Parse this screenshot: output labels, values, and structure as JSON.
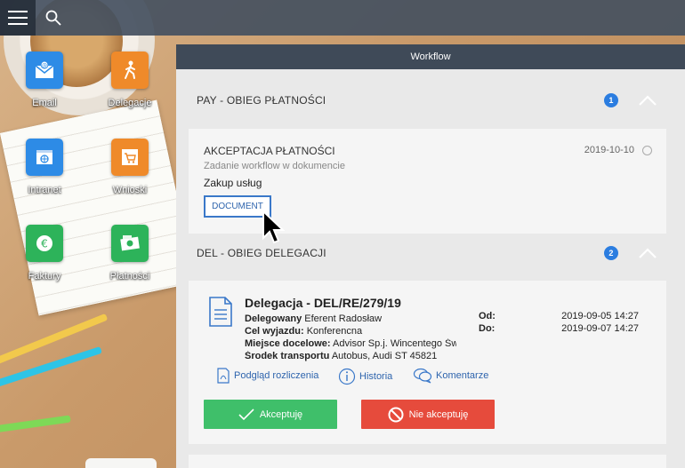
{
  "colors": {
    "topbar": "#445060",
    "panel_header": "#3f4a58",
    "badge": "#2b7de0",
    "accent_link": "#2e64ad",
    "accept": "#3fbf6a",
    "reject": "#e64b3c"
  },
  "topbar": {
    "menu_icon": "hamburger-icon",
    "search_icon": "search-icon"
  },
  "desktop_apps": [
    {
      "label": "Email",
      "icon": "email-icon",
      "color": "#2d8be6"
    },
    {
      "label": "Delegacje",
      "icon": "walking-person-icon",
      "color": "#ef8a2a"
    },
    {
      "label": "Intranet",
      "icon": "globe-window-icon",
      "color": "#2d8be6"
    },
    {
      "label": "Wnioski",
      "icon": "cart-icon",
      "color": "#ef8a2a"
    },
    {
      "label": "Faktury",
      "icon": "euro-icon",
      "color": "#2db35a"
    },
    {
      "label": "Płatności",
      "icon": "cash-icon",
      "color": "#2db35a"
    }
  ],
  "workflow": {
    "title": "Workflow",
    "sections": [
      {
        "title": "PAY - OBIEG PŁATNOŚCI",
        "count": "1",
        "card": {
          "title": "AKCEPTACJA PŁATNOŚCI",
          "subtitle": "Zadanie workflow w dokumencie",
          "description": "Zakup usług",
          "date": "2019-10-10",
          "button": "DOCUMENT"
        }
      },
      {
        "title": "DEL - OBIEG DELEGACJI",
        "count": "2",
        "card": {
          "title": "Delegacja - DEL/RE/279/19",
          "fields": [
            {
              "key": "Delegowany",
              "value": "Eferent Radosław"
            },
            {
              "key": "Cel wyjazdu:",
              "value": "Konferencna"
            },
            {
              "key": "Miejsce docelowe:",
              "value": "Advisor Sp.j. Wincentego Św"
            },
            {
              "key": "Środek transportu",
              "value": "Autobus, Audi ST 45821"
            }
          ],
          "dates": [
            {
              "key": "Od:",
              "value": "2019-09-05 14:27"
            },
            {
              "key": "Do:",
              "value": "2019-09-07 14:27"
            }
          ],
          "actions": [
            "Podgląd rozliczenia",
            "Historia",
            "Komentarze"
          ],
          "accept": "Akceptuję",
          "reject": "Nie akceptuję"
        }
      }
    ]
  }
}
